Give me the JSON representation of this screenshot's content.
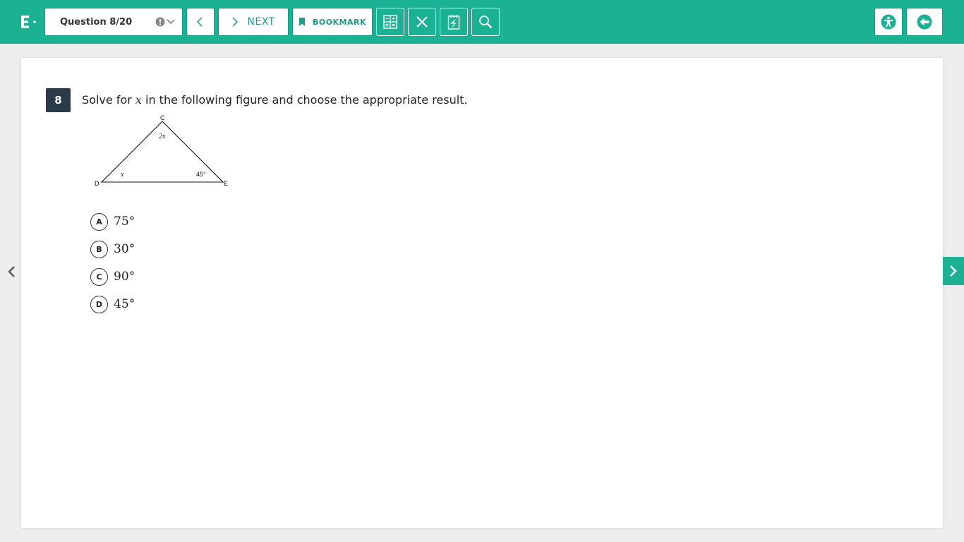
{
  "header": {
    "question_selector": "Question 8/20",
    "next_label": "NEXT",
    "bookmark_label": "BOOKMARK"
  },
  "question": {
    "number": "8",
    "text_before": "Solve for ",
    "variable": "x",
    "text_after": " in the following figure and choose the appropriate result."
  },
  "figure": {
    "vertex_top": "C",
    "vertex_left": "D",
    "vertex_right": "E",
    "angle_top": "2x",
    "angle_left": "x",
    "angle_right": "45°"
  },
  "options": [
    {
      "letter": "A",
      "value": "75°"
    },
    {
      "letter": "B",
      "value": "30°"
    },
    {
      "letter": "C",
      "value": "90°"
    },
    {
      "letter": "D",
      "value": "45°"
    }
  ],
  "colors": {
    "accent": "#1bb294",
    "badge": "#2b3a48"
  }
}
